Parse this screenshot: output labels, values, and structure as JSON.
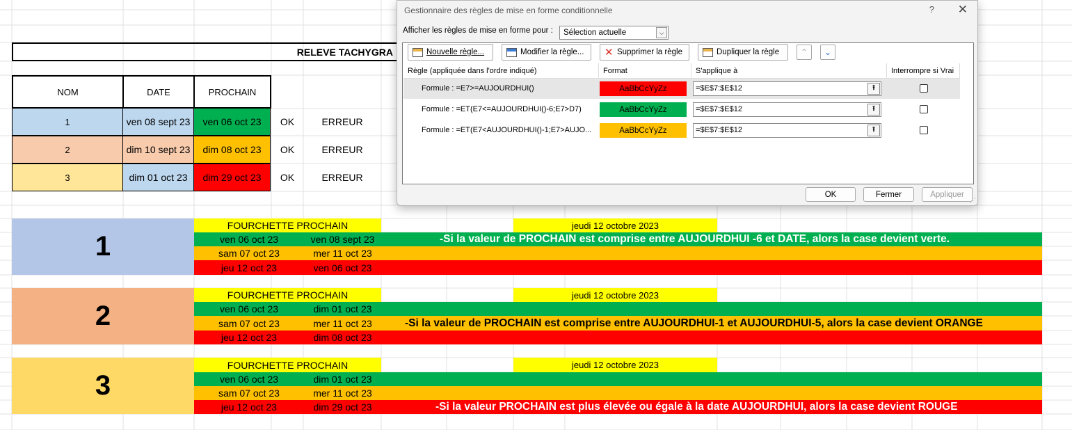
{
  "sheet": {
    "title": "RELEVE TACHYGRA",
    "headers": [
      "NOM",
      "DATE",
      "PROCHAIN"
    ],
    "rows": [
      {
        "nom": "1",
        "date": "ven 08 sept 23",
        "prochain": "ven 06 oct 23",
        "ok": "OK",
        "err": "ERREUR"
      },
      {
        "nom": "2",
        "date": "dim 10 sept 23",
        "prochain": "dim 08 oct 23",
        "ok": "OK",
        "err": "ERREUR"
      },
      {
        "nom": "3",
        "date": "dim 01 oct 23",
        "prochain": "dim 29 oct 23",
        "ok": "OK",
        "err": "ERREUR"
      }
    ],
    "blocks": [
      {
        "num": "1",
        "label": "FOURCHETTE PROCHAIN",
        "today": "jeudi 12 octobre 2023",
        "rows": [
          {
            "a": "ven 06 oct 23",
            "b": "ven 08 sept 23",
            "note": "-Si la valeur de PROCHAIN est comprise entre AUJOURDHUI -6 et DATE, alors la case devient verte."
          },
          {
            "a": "sam 07 oct 23",
            "b": "mer 11 oct 23",
            "note": ""
          },
          {
            "a": "jeu 12 oct 23",
            "b": "ven 06 oct 23",
            "note": ""
          }
        ]
      },
      {
        "num": "2",
        "label": "FOURCHETTE PROCHAIN",
        "today": "jeudi 12 octobre 2023",
        "rows": [
          {
            "a": "ven 06 oct 23",
            "b": "dim 01 oct 23",
            "note": ""
          },
          {
            "a": "sam 07 oct 23",
            "b": "mer 11 oct 23",
            "note": "-Si la valeur de PROCHAIN est comprise entre AUJOURDHUI-1 et AUJOURDHUI-5, alors la case devient ORANGE"
          },
          {
            "a": "jeu 12 oct 23",
            "b": "dim 08 oct 23",
            "note": ""
          }
        ]
      },
      {
        "num": "3",
        "label": "FOURCHETTE PROCHAIN",
        "today": "jeudi 12 octobre 2023",
        "rows": [
          {
            "a": "ven 06 oct 23",
            "b": "dim 01 oct 23",
            "note": ""
          },
          {
            "a": "sam 07 oct 23",
            "b": "mer 11 oct 23",
            "note": ""
          },
          {
            "a": "jeu 12 oct 23",
            "b": "dim 29 oct 23",
            "note": "-Si la valeur PROCHAIN est plus élevée ou égale à la date AUJOURDHUI, alors la case devient ROUGE"
          }
        ]
      }
    ]
  },
  "dialog": {
    "title": "Gestionnaire des règles de mise en forme conditionnelle",
    "help": "?",
    "close": "✕",
    "show_label": "Afficher les règles de mise en forme pour :",
    "show_value": "Sélection actuelle",
    "toolbar": {
      "new": "Nouvelle règle...",
      "edit": "Modifier la règle...",
      "delete": "Supprimer la règle",
      "duplicate": "Dupliquer la règle"
    },
    "columns": {
      "rule": "Règle (appliquée dans l'ordre indiqué)",
      "format": "Format",
      "applies": "S'applique à",
      "stop": "Interrompre si Vrai"
    },
    "rules": [
      {
        "formula": "Formule : =E7>=AUJOURDHUI()",
        "preview": "AaBbCcYyZz",
        "applies": "=$E$7:$E$12",
        "color": "#ff0000"
      },
      {
        "formula": "Formule : =ET(E7<=AUJOURDHUI()-6;E7>D7)",
        "preview": "AaBbCcYyZz",
        "applies": "=$E$7:$E$12",
        "color": "#00b050"
      },
      {
        "formula": "Formule : =ET(E7<AUJOURDHUI()-1;E7>AUJO...",
        "preview": "AaBbCcYyZz",
        "applies": "=$E$7:$E$12",
        "color": "#ffc000"
      }
    ],
    "buttons": {
      "ok": "OK",
      "close": "Fermer",
      "apply": "Appliquer"
    }
  },
  "colors": {
    "green": "#00b050",
    "orange": "#ffc000",
    "red": "#ff0000",
    "yellow": "#ffff00",
    "blue_light": "#bdd7ee",
    "salmon": "#f8cbad",
    "cream": "#ffe699"
  }
}
